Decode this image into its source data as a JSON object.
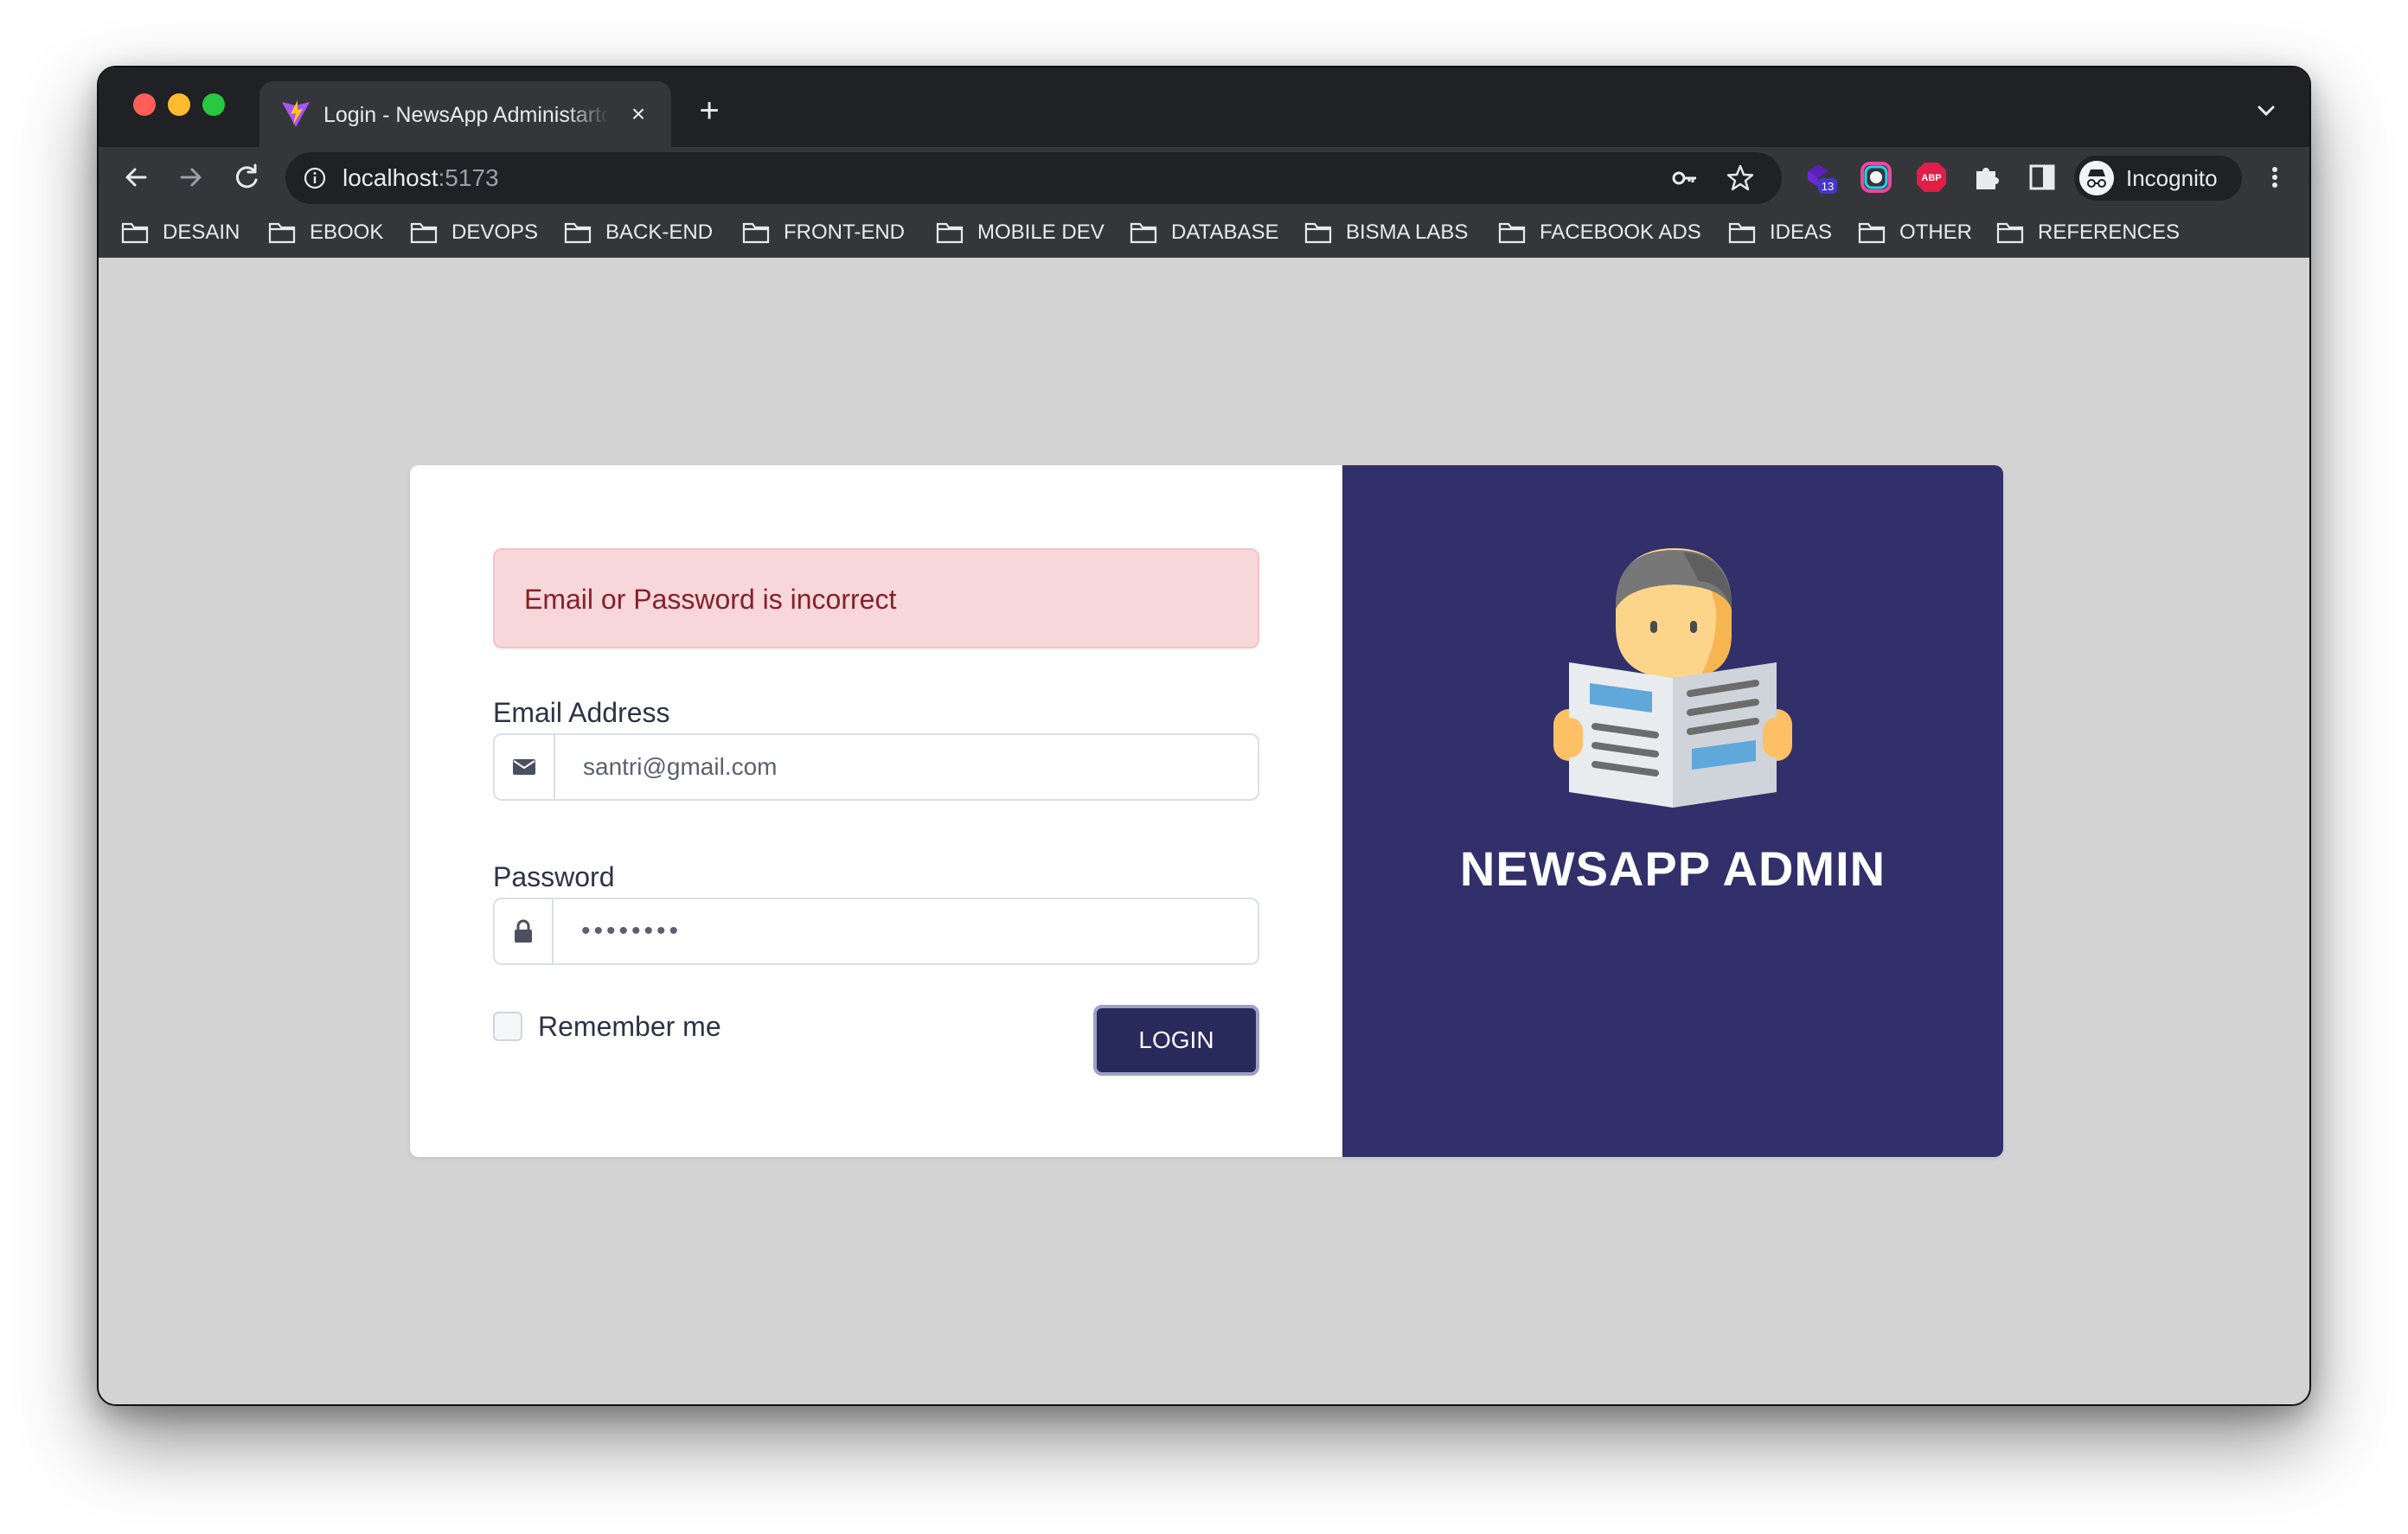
{
  "browser": {
    "tab_title": "Login - NewsApp Administartor",
    "tab_close": "×",
    "new_tab": "+",
    "url_host": "localhost",
    "url_port": ":5173",
    "extension_badge": "13",
    "profile_label": "Incognito",
    "bookmarks": [
      "DESAIN",
      "EBOOK",
      "DEVOPS",
      "BACK-END",
      "FRONT-END",
      "MOBILE DEV",
      "DATABASE",
      "BISMA LABS",
      "FACEBOOK ADS",
      "IDEAS",
      "OTHER",
      "REFERENCES"
    ]
  },
  "login": {
    "alert_text": "Email or Password is incorrect",
    "email_label": "Email Address",
    "email_value": "santri@gmail.com",
    "password_label": "Password",
    "password_value": "••••••••",
    "remember_label": "Remember me",
    "remember_checked": false,
    "login_button": "LOGIN"
  },
  "brand": {
    "title": "NEWSAPP ADMIN"
  },
  "colors": {
    "brand_panel": "#31306b",
    "login_button": "#282a5c",
    "alert_bg": "#f8d7da",
    "alert_text": "#842029",
    "page_bg": "#d3d3d3"
  },
  "icons": {
    "email_addon": "envelope-icon",
    "password_addon": "lock-icon",
    "brand_illustration": "man-reading-newspaper-icon"
  }
}
